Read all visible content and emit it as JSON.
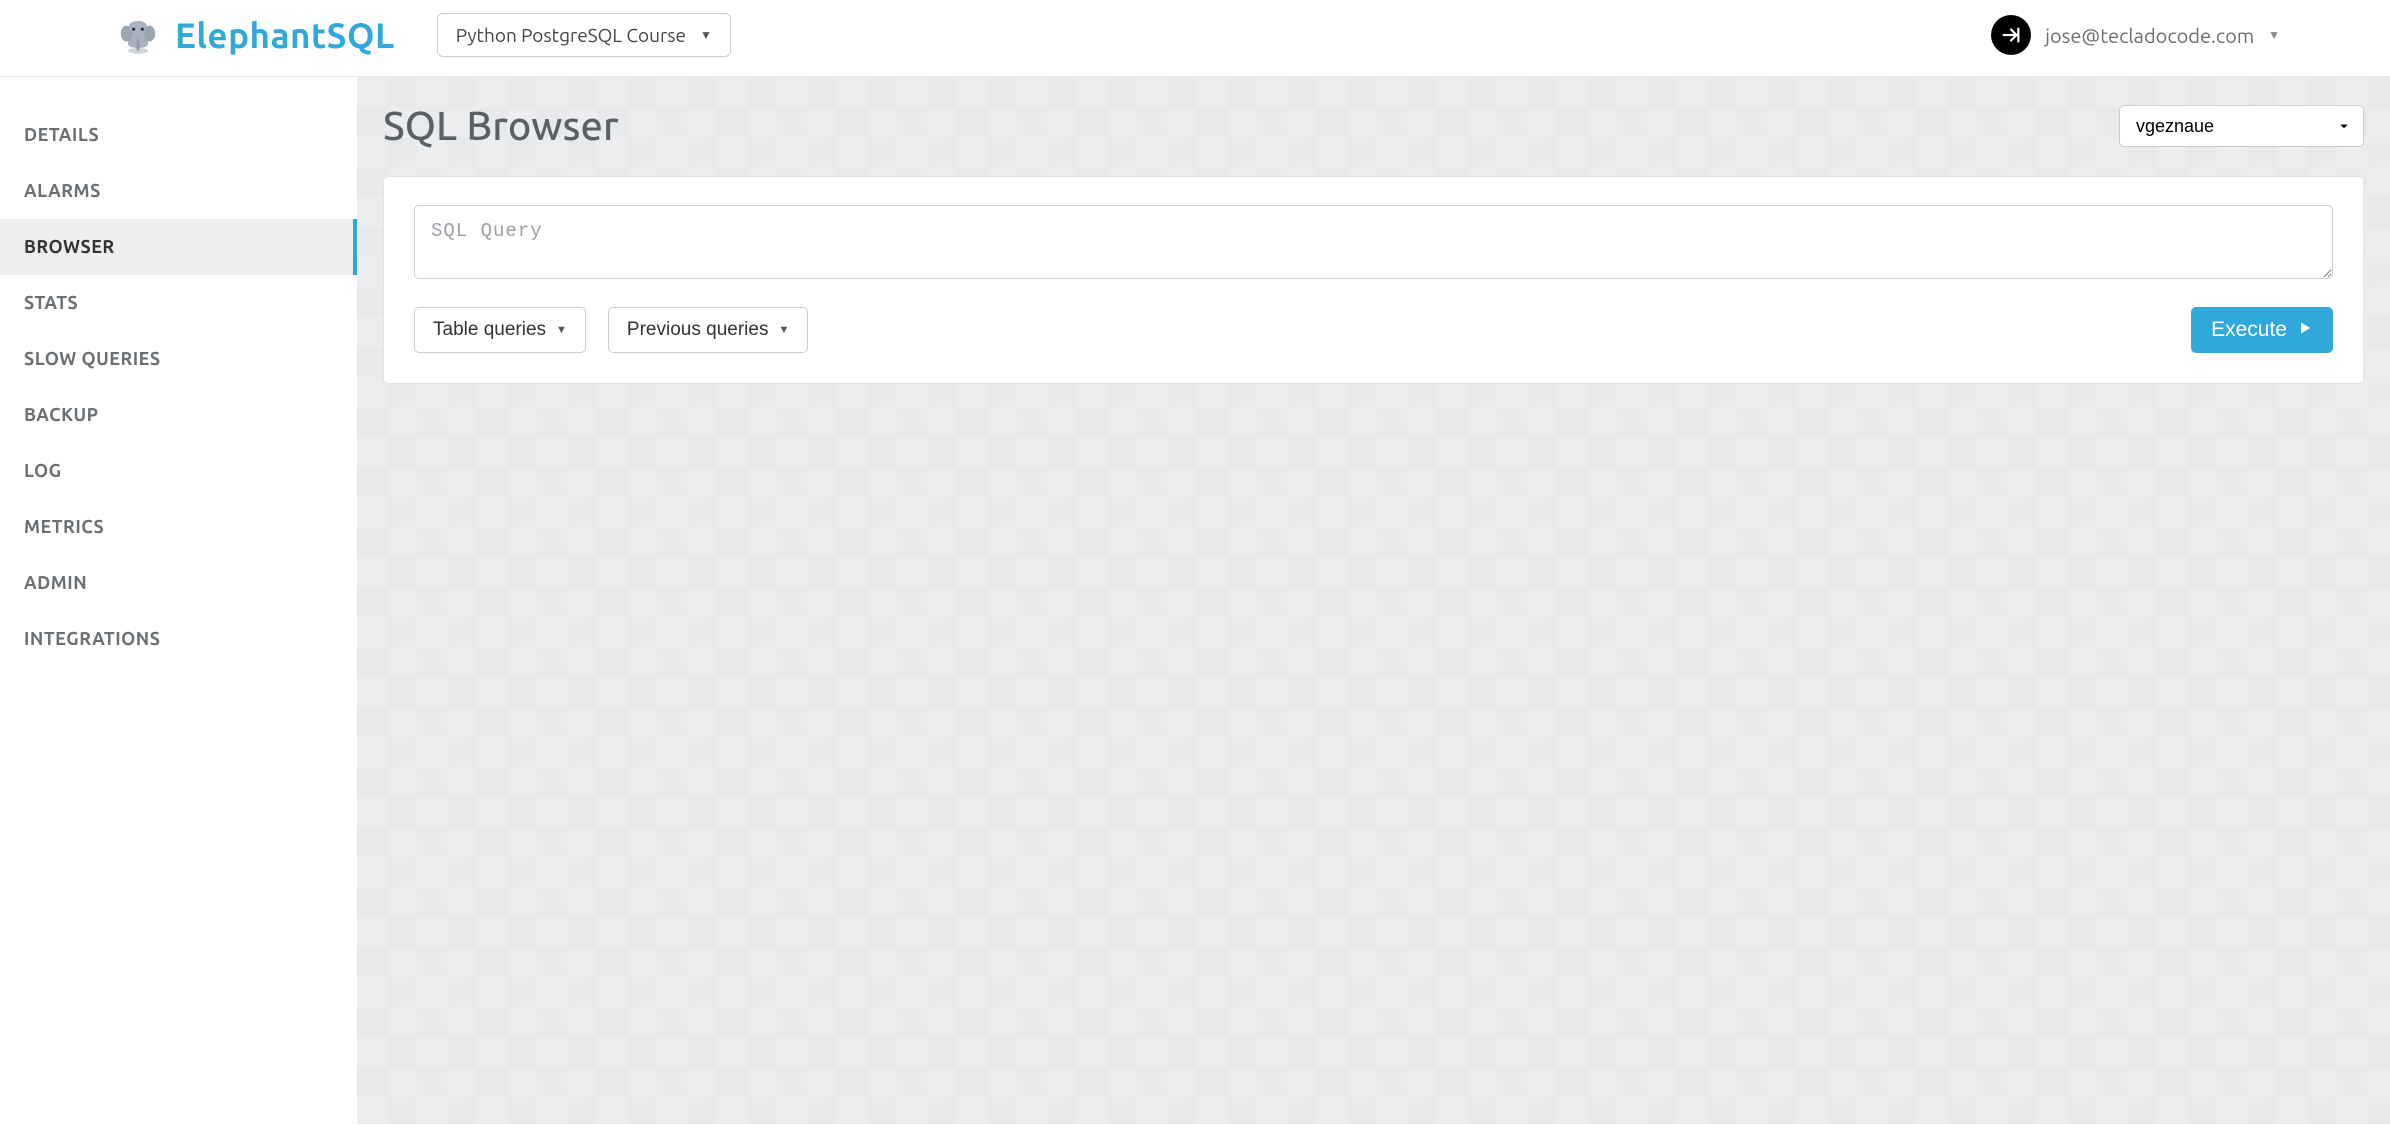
{
  "brand": {
    "name": "ElephantSQL"
  },
  "project_selector": {
    "label": "Python PostgreSQL Course"
  },
  "user": {
    "email": "jose@tecladocode.com"
  },
  "sidebar": {
    "items": [
      {
        "label": "DETAILS"
      },
      {
        "label": "ALARMS"
      },
      {
        "label": "BROWSER"
      },
      {
        "label": "STATS"
      },
      {
        "label": "SLOW QUERIES"
      },
      {
        "label": "BACKUP"
      },
      {
        "label": "LOG"
      },
      {
        "label": "METRICS"
      },
      {
        "label": "ADMIN"
      },
      {
        "label": "INTEGRATIONS"
      }
    ],
    "active_index": 2
  },
  "main": {
    "title": "SQL Browser",
    "database_selector": {
      "selected": "vgeznaue"
    },
    "query_input": {
      "placeholder": "SQL Query",
      "value": ""
    },
    "table_queries_label": "Table queries",
    "previous_queries_label": "Previous queries",
    "execute_label": "Execute"
  },
  "colors": {
    "brand_blue": "#31a8db",
    "sidebar_active_bg": "#eceeef",
    "main_bg": "#ebedef"
  }
}
